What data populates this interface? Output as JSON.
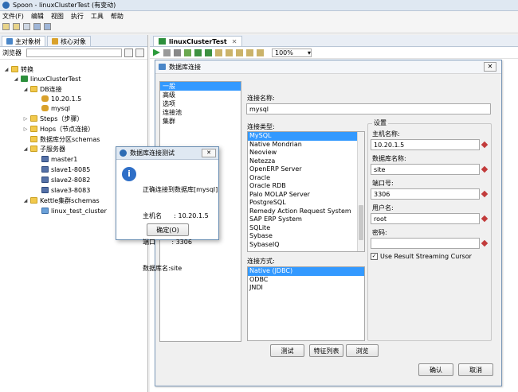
{
  "window": {
    "title": "Spoon - linuxClusterTest (有变动)"
  },
  "menu": [
    "文件(F)",
    "编辑",
    "视图",
    "执行",
    "工具",
    "帮助"
  ],
  "left_tabs": {
    "main": "主对象树",
    "core": "核心对象"
  },
  "browser_label": "浏览器",
  "tree": {
    "root": "转换",
    "transform": "linuxClusterTest",
    "db_conn": "DB连接",
    "db1": "10.20.1.5",
    "db2": "mysql",
    "steps": "Steps（步骤）",
    "hops": "Hops（节点连接）",
    "partition": "数据库分区schemas",
    "servers": "子服务器",
    "s1": "master1",
    "s2": "slave1-8085",
    "s3": "slave2-8082",
    "s4": "slave3-8083",
    "kettle": "Kettle集群schemas",
    "cluster": "linux_test_cluster"
  },
  "editor": {
    "tab": "linuxClusterTest",
    "zoom": "100%"
  },
  "db_dialog": {
    "title": "数据库连接",
    "nav": [
      "一般",
      "高级",
      "选项",
      "连接池",
      "集群"
    ],
    "conn_name_label": "连接名称:",
    "conn_name_value": "mysql",
    "conn_type_label": "连接类型:",
    "conn_types": [
      "MySQL",
      "Native Mondrian",
      "Neoview",
      "Netezza",
      "OpenERP Server",
      "Oracle",
      "Oracle RDB",
      "Palo MOLAP Server",
      "PostgreSQL",
      "Remedy Action Request System",
      "SAP ERP System",
      "SQLite",
      "Sybase",
      "SybaseIQ"
    ],
    "access_label": "连接方式:",
    "access_types": [
      "Native (JDBC)",
      "ODBC",
      "JNDI"
    ],
    "settings_title": "设置",
    "host_label": "主机名称:",
    "host_value": "10.20.1.5",
    "dbname_label": "数据库名称:",
    "dbname_value": "site",
    "port_label": "端口号:",
    "port_value": "3306",
    "user_label": "用户名:",
    "user_value": "root",
    "pwd_label": "密码:",
    "pwd_value": "",
    "streaming_label": "Use Result Streaming Cursor",
    "btn_test": "测试",
    "btn_features": "特征列表",
    "btn_explore": "浏览",
    "btn_ok": "确认",
    "btn_cancel": "取消"
  },
  "test_dialog": {
    "title": "数据库连接测试",
    "line1": "正确连接到数据库[mysql]",
    "line2": "主机名      : 10.20.1.5",
    "line3": "端口        : 3306",
    "line4": "数据库名:site",
    "ok": "确定(O)"
  }
}
